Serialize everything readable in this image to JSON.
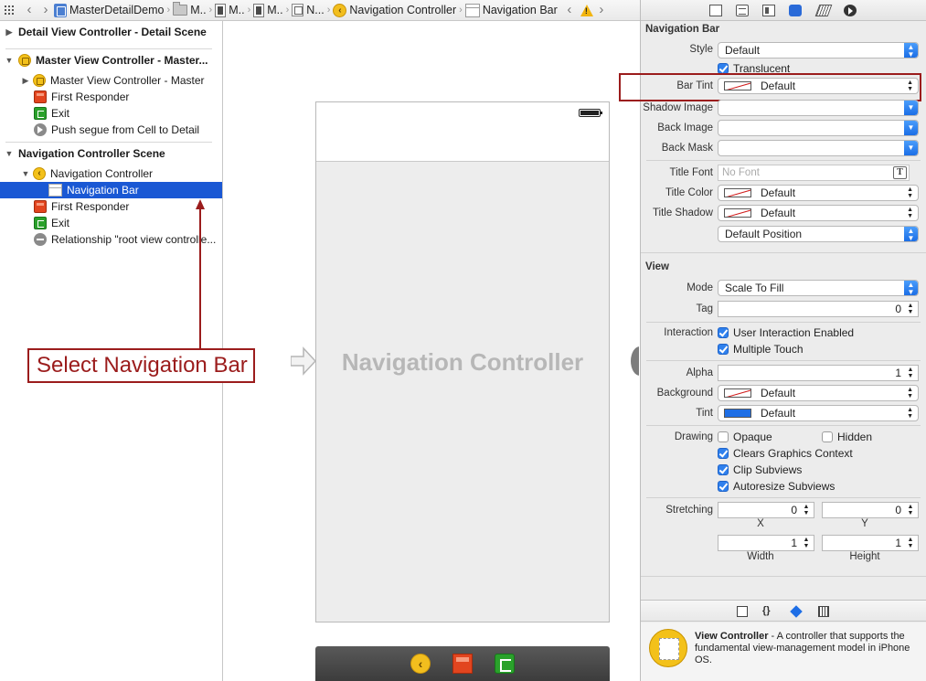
{
  "jumpbar": {
    "items": [
      {
        "label": "MasterDetailDemo",
        "icon": "project-icon"
      },
      {
        "label": "M..",
        "icon": "folder-icon"
      },
      {
        "label": "M..",
        "icon": "storyboard-icon"
      },
      {
        "label": "M..",
        "icon": "storyboard-icon"
      },
      {
        "label": "N...",
        "icon": "scene-icon"
      },
      {
        "label": "Navigation Controller",
        "icon": "navigation-controller-icon"
      },
      {
        "label": "Navigation Bar",
        "icon": "navigation-bar-icon"
      }
    ],
    "warning_icon": "warning-icon"
  },
  "outline": {
    "rows": [
      {
        "label": "Detail View Controller - Detail Scene",
        "type": "scene",
        "expanded": false
      },
      {
        "label": "Master View Controller - Master...",
        "type": "scene",
        "expanded": true
      },
      {
        "label": "Master View Controller - Master",
        "type": "view-controller"
      },
      {
        "label": "First Responder",
        "type": "first-responder"
      },
      {
        "label": "Exit",
        "type": "exit"
      },
      {
        "label": "Push segue from Cell to Detail",
        "type": "segue"
      },
      {
        "label": "Navigation Controller Scene",
        "type": "scene",
        "expanded": true
      },
      {
        "label": "Navigation Controller",
        "type": "navigation-controller"
      },
      {
        "label": "Navigation Bar",
        "type": "navigation-bar",
        "selected": true
      },
      {
        "label": "First Responder",
        "type": "first-responder"
      },
      {
        "label": "Exit",
        "type": "exit"
      },
      {
        "label": "Relationship \"root view controlle...",
        "type": "relationship"
      }
    ]
  },
  "canvas": {
    "scene_title": "Navigation Controller",
    "dock_icons": [
      "navigation-controller-icon",
      "first-responder-icon",
      "exit-icon"
    ]
  },
  "annotation": {
    "callout": "Select Navigation Bar",
    "color": "#9b1c1c"
  },
  "inspector": {
    "navigation_bar": {
      "section": "Navigation Bar",
      "style_label": "Style",
      "style_value": "Default",
      "translucent_label": "Translucent",
      "translucent": true,
      "bar_tint_label": "Bar Tint",
      "bar_tint_value": "Default",
      "shadow_image_label": "Shadow Image",
      "shadow_image_value": "",
      "back_image_label": "Back Image",
      "back_image_value": "",
      "back_mask_label": "Back Mask",
      "back_mask_value": "",
      "title_font_label": "Title Font",
      "title_font_placeholder": "No Font",
      "title_color_label": "Title Color",
      "title_color_value": "Default",
      "title_shadow_label": "Title Shadow",
      "title_shadow_value": "Default",
      "position_value": "Default Position"
    },
    "view": {
      "section": "View",
      "mode_label": "Mode",
      "mode_value": "Scale To Fill",
      "tag_label": "Tag",
      "tag_value": "0",
      "interaction_label": "Interaction",
      "user_interaction": "User Interaction Enabled",
      "user_interaction_checked": true,
      "multiple_touch": "Multiple Touch",
      "multiple_touch_checked": true,
      "alpha_label": "Alpha",
      "alpha_value": "1",
      "background_label": "Background",
      "background_value": "Default",
      "tint_label": "Tint",
      "tint_value": "Default",
      "tint_color": "#1f6fe6",
      "drawing_label": "Drawing",
      "opaque": "Opaque",
      "opaque_checked": false,
      "hidden": "Hidden",
      "hidden_checked": false,
      "clears": "Clears Graphics Context",
      "clears_checked": true,
      "clip": "Clip Subviews",
      "clip_checked": true,
      "autoresize": "Autoresize Subviews",
      "autoresize_checked": true,
      "stretching_label": "Stretching",
      "stretch_x": "0",
      "stretch_y": "0",
      "x_label": "X",
      "y_label": "Y",
      "stretch_w": "1",
      "stretch_h": "1",
      "width_label": "Width",
      "height_label": "Height"
    },
    "library": {
      "tab_icons": [
        "file-template-icon",
        "code-snippet-icon",
        "object-library-icon",
        "media-library-icon"
      ],
      "item_title": "View Controller",
      "item_desc": " - A controller that supports the fundamental view-management model in iPhone OS."
    }
  }
}
